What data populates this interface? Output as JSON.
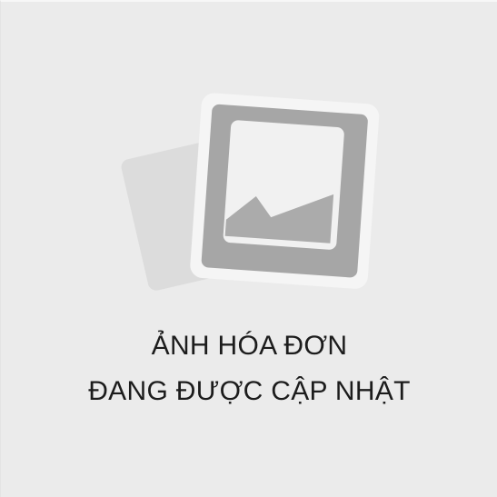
{
  "placeholder": {
    "icon": "image-placeholder-icon",
    "line1": "ẢNH HÓA ĐƠN",
    "line2": "ĐANG ĐƯỢC CẬP NHẬT"
  },
  "colors": {
    "background": "#ebebeb",
    "back_card": "#dcdcdc",
    "front_frame": "#f4f4f4",
    "photo_border": "#a5a5a5",
    "photo_inner": "#f2f2f2",
    "mountain": "#acacac",
    "text": "#1c1c1c"
  }
}
